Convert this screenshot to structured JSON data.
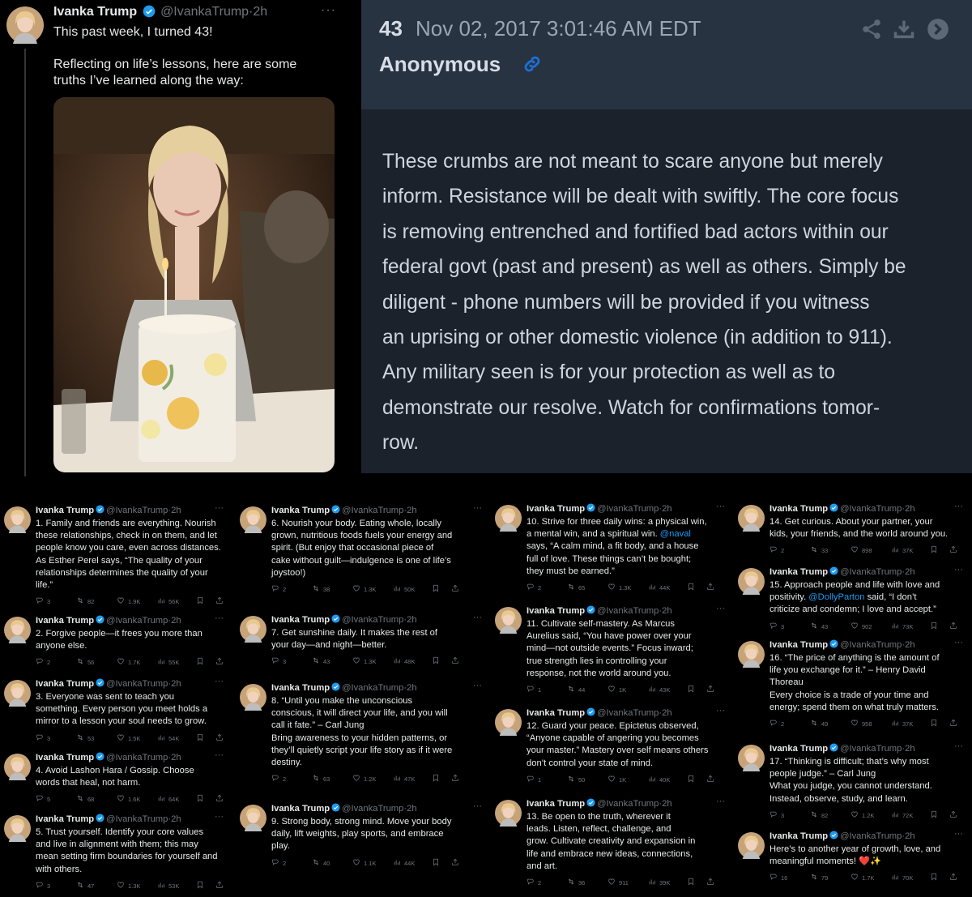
{
  "main_tweet": {
    "name": "Ivanka Trump",
    "handle": "@IvankaTrump",
    "time": "2h",
    "more": "···",
    "text": "This past week, I turned 43!\n\nReflecting on life’s lessons, here are some\ntruths I’ve learned along the way:"
  },
  "drop": {
    "number": "43",
    "date": "Nov 02, 2017 3:01:46 AM EDT",
    "author": "Anonymous",
    "body_lines": [
      "These crumbs are not meant to scare anyone but merely",
      "inform. Resistance will be dealt with swiftly. The core focus",
      "is removing entrenched and fortified bad actors within our",
      "federal govt (past and present) as well as others. Simply be",
      "diligent - phone numbers will be provided if you witness",
      "an uprising or other domestic violence (in addition to 911).",
      "Any military seen is for your protection as well as to",
      "demonstrate our resolve. Watch for confirmations tomor-",
      "row."
    ]
  },
  "cards": [
    {
      "name": "Ivanka Trump",
      "handle": "@IvankaTrump",
      "time": "2h",
      "text": "1. Family and friends are everything. Nourish\nthese relationships, check in on them, and let\npeople know you care, even across distances.\nAs Esther Perel says, “The quality of your\nrelationships determines the quality of your\nlife.”",
      "metrics": {
        "replies": "3",
        "reposts": "82",
        "likes": "1.9K",
        "views": "56K"
      }
    },
    {
      "name": "Ivanka Trump",
      "handle": "@IvankaTrump",
      "time": "2h",
      "text": "2. Forgive people—it frees you more than\nanyone else.",
      "metrics": {
        "replies": "2",
        "reposts": "56",
        "likes": "1.7K",
        "views": "55K"
      }
    },
    {
      "name": "Ivanka Trump",
      "handle": "@IvankaTrump",
      "time": "2h",
      "text": "3. Everyone was sent to teach you\nsomething. Every person you meet holds a\nmirror to a lesson your soul needs to grow.",
      "metrics": {
        "replies": "3",
        "reposts": "53",
        "likes": "1.5K",
        "views": "54K"
      }
    },
    {
      "name": "Ivanka Trump",
      "handle": "@IvankaTrump",
      "time": "2h",
      "text": "4. Avoid Lashon Hara / Gossip. Choose\nwords that heal, not harm.",
      "metrics": {
        "replies": "5",
        "reposts": "68",
        "likes": "1.6K",
        "views": "64K"
      }
    },
    {
      "name": "Ivanka Trump",
      "handle": "@IvankaTrump",
      "time": "2h",
      "text": "5. Trust yourself. Identify your core values\nand live in alignment with them; this may\nmean setting firm boundaries for yourself and\nwith others.",
      "metrics": {
        "replies": "3",
        "reposts": "47",
        "likes": "1.3K",
        "views": "53K"
      }
    },
    {
      "name": "Ivanka Trump",
      "handle": "@IvankaTrump",
      "time": "2h",
      "text": "6. Nourish your body. Eating whole, locally\ngrown, nutritious foods fuels your energy and\nspirit. (But enjoy that occasional piece of\ncake without guilt—indulgence is one of life’s\njoystoo!)",
      "metrics": {
        "replies": "2",
        "reposts": "38",
        "likes": "1.3K",
        "views": "50K"
      }
    },
    {
      "name": "Ivanka Trump",
      "handle": "@IvankaTrump",
      "time": "2h",
      "text": "7. Get sunshine daily. It makes the rest of\nyour day—and night—better.",
      "metrics": {
        "replies": "3",
        "reposts": "43",
        "likes": "1.3K",
        "views": "48K"
      }
    },
    {
      "name": "Ivanka Trump",
      "handle": "@IvankaTrump",
      "time": "2h",
      "text": "8. “Until you make the unconscious\nconscious, it will direct your life, and you will\ncall it fate.” – Carl Jung\nBring awareness to your hidden patterns, or\nthey’ll quietly script your life story as if it were\ndestiny.",
      "metrics": {
        "replies": "2",
        "reposts": "63",
        "likes": "1.2K",
        "views": "47K"
      }
    },
    {
      "name": "Ivanka Trump",
      "handle": "@IvankaTrump",
      "time": "2h",
      "text": "9. Strong body, strong mind. Move your body\ndaily, lift weights, play sports, and embrace\nplay.",
      "metrics": {
        "replies": "2",
        "reposts": "40",
        "likes": "1.1K",
        "views": "44K"
      }
    },
    {
      "name": "Ivanka Trump",
      "handle": "@IvankaTrump",
      "time": "2h",
      "text_before": "10. Strive for three daily wins: a physical win,\na mental win, and a spiritual win. ",
      "mention": "@naval",
      "text_after": "\nsays, “A calm mind, a fit body, and a house\nfull of love. These things can’t be bought;\nthey must be earned.”",
      "metrics": {
        "replies": "2",
        "reposts": "65",
        "likes": "1.3K",
        "views": "44K"
      }
    },
    {
      "name": "Ivanka Trump",
      "handle": "@IvankaTrump",
      "time": "2h",
      "text": "11. Cultivate self-mastery. As Marcus\nAurelius said, “You have power over your\nmind—not outside events.” Focus inward;\ntrue strength lies in controlling your\nresponse, not the world around you.",
      "metrics": {
        "replies": "1",
        "reposts": "44",
        "likes": "1K",
        "views": "43K"
      }
    },
    {
      "name": "Ivanka Trump",
      "handle": "@IvankaTrump",
      "time": "2h",
      "text": "12. Guard your peace. Epictetus observed,\n“Anyone capable of angering you becomes\nyour master.” Mastery over self means others\ndon’t control your state of mind.",
      "metrics": {
        "replies": "1",
        "reposts": "50",
        "likes": "1K",
        "views": "40K"
      }
    },
    {
      "name": "Ivanka Trump",
      "handle": "@IvankaTrump",
      "time": "2h",
      "text": "13. Be open to the truth, wherever it\nleads. Listen, reflect, challenge, and\ngrow. Cultivate creativity and expansion in\nlife and embrace new ideas, connections,\nand art.",
      "metrics": {
        "replies": "2",
        "reposts": "36",
        "likes": "911",
        "views": "39K"
      }
    },
    {
      "name": "Ivanka Trump",
      "handle": "@IvankaTrump",
      "time": "2h",
      "text": "14. Get curious. About your partner, your\nkids, your friends, and the world around you.",
      "metrics": {
        "replies": "2",
        "reposts": "33",
        "likes": "898",
        "views": "37K"
      }
    },
    {
      "name": "Ivanka Trump",
      "handle": "@IvankaTrump",
      "time": "2h",
      "text_before": "15. Approach people and life with love and\npositivity. ",
      "mention": "@DollyParton",
      "text_after": " said, “I don’t\ncriticize and condemn; I love and accept.”",
      "metrics": {
        "replies": "3",
        "reposts": "43",
        "likes": "902",
        "views": "73K"
      }
    },
    {
      "name": "Ivanka Trump",
      "handle": "@IvankaTrump",
      "time": "2h",
      "text": "16. “The price of anything is the amount of\nlife you exchange for it.” – Henry David\nThoreau\nEvery choice is a trade of your time and\nenergy; spend them on what truly matters.",
      "metrics": {
        "replies": "2",
        "reposts": "49",
        "likes": "958",
        "views": "37K"
      }
    },
    {
      "name": "Ivanka Trump",
      "handle": "@IvankaTrump",
      "time": "2h",
      "text": "17. “Thinking is difficult; that’s why most\npeople judge.” – Carl Jung\nWhat you judge, you cannot understand.\nInstead, observe, study, and learn.",
      "metrics": {
        "replies": "3",
        "reposts": "82",
        "likes": "1.2K",
        "views": "72K"
      }
    },
    {
      "name": "Ivanka Trump",
      "handle": "@IvankaTrump",
      "time": "2h",
      "text": "Here’s to another year of growth, love, and\nmeaningful moments! ❤️✨",
      "metrics": {
        "replies": "16",
        "reposts": "79",
        "likes": "1.7K",
        "views": "70K"
      }
    }
  ],
  "colors": {
    "verified": "#1d9bf0",
    "muted": "#71767b",
    "drop_header": "#283341",
    "drop_body": "#1b222c"
  },
  "icons": [
    "verified-badge-icon",
    "more-icon",
    "reply-icon",
    "repost-icon",
    "like-icon",
    "views-icon",
    "bookmark-icon",
    "share-icon",
    "link-icon",
    "share-nodes-icon",
    "download-icon",
    "arrow-right-circle-icon"
  ]
}
